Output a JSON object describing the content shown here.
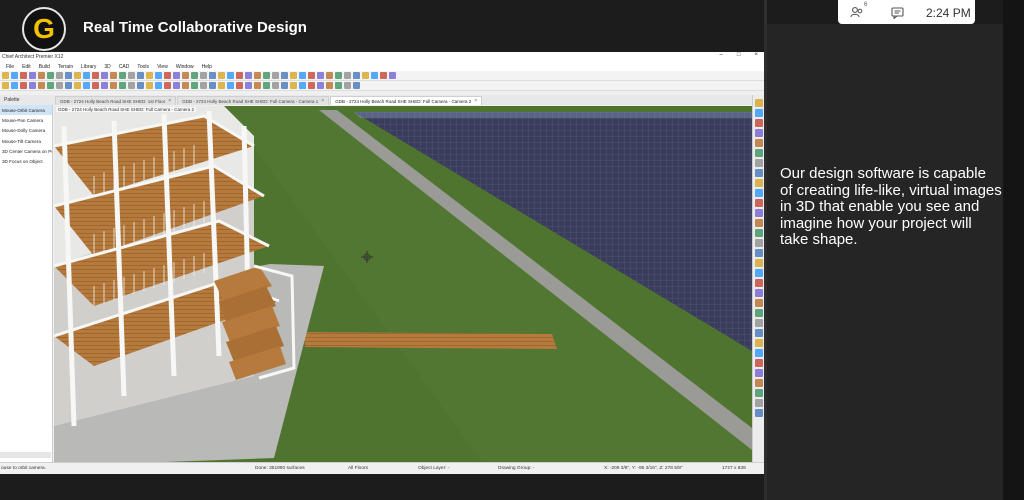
{
  "screen_share": {
    "logo_letter": "G",
    "title": "Real Time Collaborative Design"
  },
  "status_pill": {
    "participants_icon": "people-icon",
    "participants_count": "6",
    "chat_icon": "chat-icon",
    "time": "2:24 PM"
  },
  "app": {
    "window_title": "Chief Architect Premier X12",
    "window_controls": [
      "–",
      "□",
      "×"
    ],
    "menu": [
      "File",
      "Edit",
      "Build",
      "Terrain",
      "Library",
      "3D",
      "CAD",
      "Tools",
      "View",
      "Window",
      "Help"
    ],
    "palette_title": "Palette",
    "tabs": [
      {
        "label": "GDB - 2724 Holly Beach Road SHE SHED: 1st Floor",
        "active": false
      },
      {
        "label": "GDB - 2724 Holly Beach Road SHE SHED: Full Camera - Camera 1",
        "active": false
      },
      {
        "label": "GDB - 2724 Holly Beach Road SHE SHED: Full Camera - Camera 2",
        "active": true
      }
    ],
    "viewport_label": "GDB - 2724 Holly Beach Road SHE SHED: Full Camera - Camera 2",
    "palette_items": [
      "Mouse-Orbit Camera",
      "Mouse-Pan Camera",
      "Mouse-Dolly Camera",
      "Mouse-Tilt Camera",
      "3D Center Camera on Point",
      "3D Focus on Object"
    ],
    "palette_selected_index": 0,
    "status": {
      "hint": "ouse to orbit camera.",
      "done": "Done:  351990 surfaces",
      "floors": "All Floors",
      "object_layer": "Object Layer: -",
      "drawing_group": "Drawing Group: -",
      "coords": "X: -209 3/8\",  Y: -95 3/16\",  Z: 278 5/8\"",
      "size": "1727 x 838"
    }
  },
  "panel_text": "Our design software is capable of creating life-like, virtual images in 3D that enable you see and imagine how your project will take shape.",
  "colors": {
    "logo_yellow": "#f2c200",
    "grass": "#4f7430",
    "solar_panels": "#3a3c5c",
    "deck_wood": "#b57a3c",
    "panel_bg": "#252525"
  }
}
